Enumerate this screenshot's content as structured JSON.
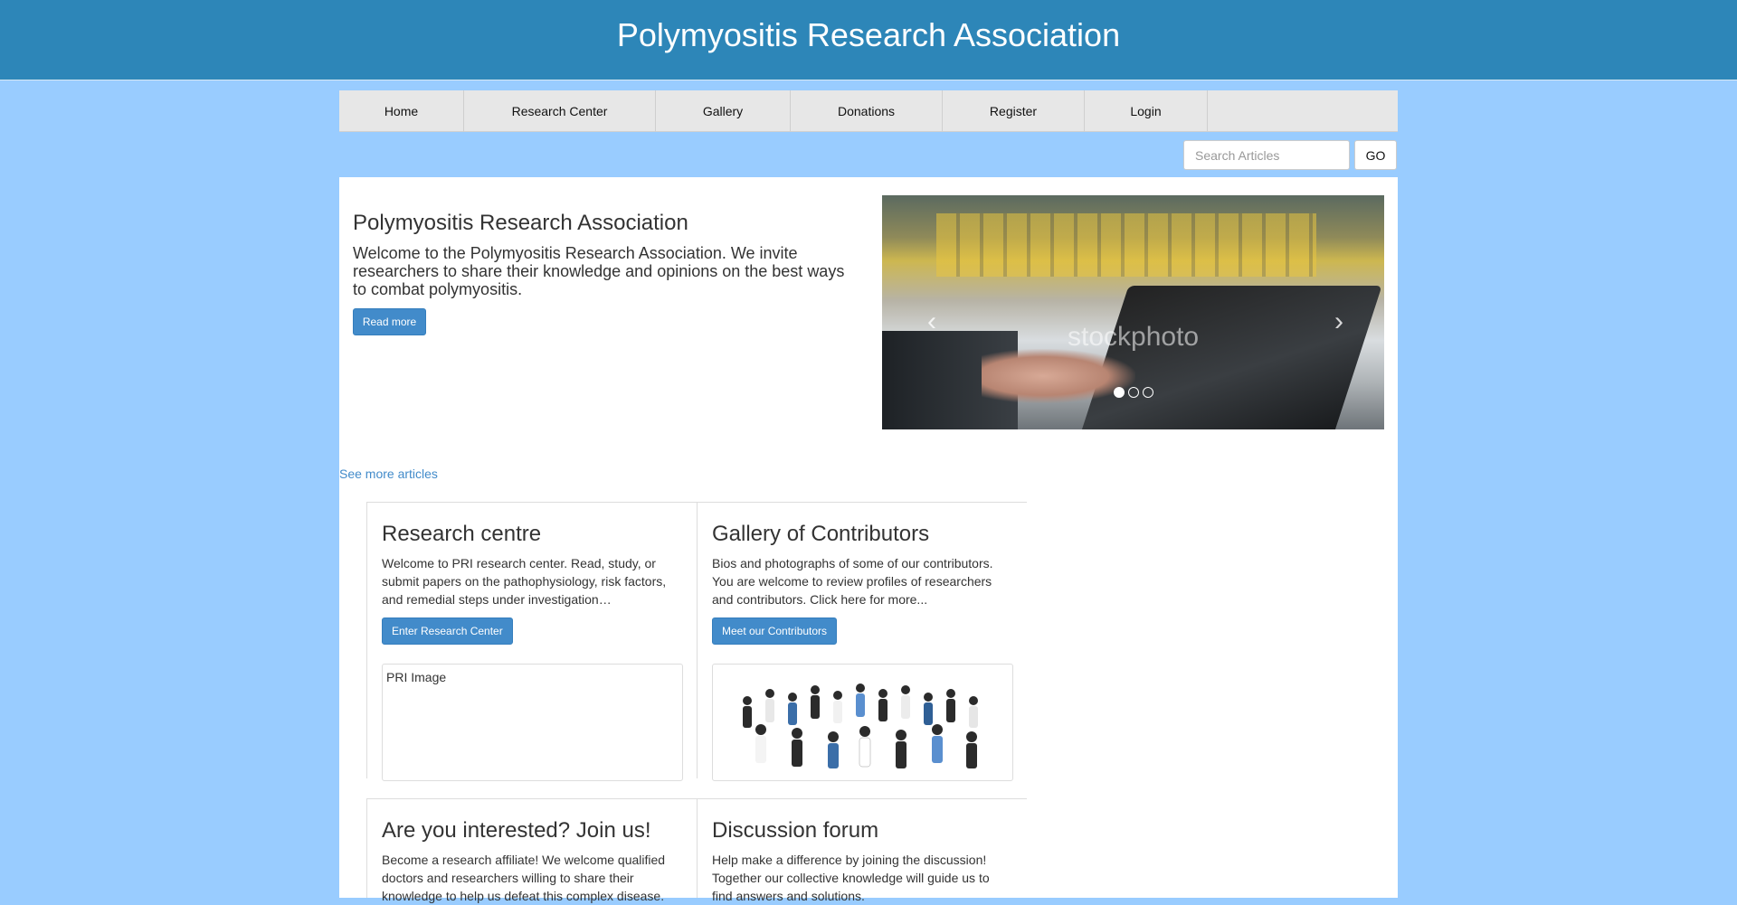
{
  "header": {
    "title": "Polymyositis Research Association"
  },
  "nav": {
    "items": [
      {
        "label": "Home"
      },
      {
        "label": "Research Center"
      },
      {
        "label": "Gallery"
      },
      {
        "label": "Donations"
      },
      {
        "label": "Register"
      },
      {
        "label": "Login"
      }
    ]
  },
  "search": {
    "placeholder": "Search Articles",
    "value": "",
    "button_label": "GO"
  },
  "hero": {
    "title": "Polymyositis Research Association",
    "text": "Welcome to the Polymyositis Research Association. We invite researchers to share their knowledge and opinions on the best ways to combat polymyositis.",
    "button_label": "Read more"
  },
  "carousel": {
    "watermark": "stockphoto",
    "prev_icon": "chevron-left-icon",
    "next_icon": "chevron-right-icon",
    "slide_count": 3,
    "active_slide": 1
  },
  "see_more": {
    "label": "See more articles"
  },
  "cards": [
    {
      "title": "Research centre",
      "text": "Welcome to PRI research center. Read, study, or submit papers on the pathophysiology, risk factors, and remedial steps under investigation…",
      "button_label": "Enter Research Center",
      "image_alt": "PRI Image"
    },
    {
      "title": "Gallery of Contributors",
      "text": "Bios and photographs of some of our contributors. You are welcome to review profiles of researchers and contributors. Click here for more...",
      "button_label": "Meet our Contributors"
    },
    {
      "title": "Are you interested? Join us!",
      "text": "Become a research affiliate! We welcome qualified doctors and researchers willing to share their knowledge to help us defeat this complex disease."
    },
    {
      "title": "Discussion forum",
      "text": "Help make a difference by joining the discussion! Together our collective knowledge will guide us to find answers and solutions."
    }
  ],
  "colors": {
    "header_bg": "#2d86b8",
    "page_bg": "#99ccff",
    "primary": "#428bca",
    "nav_bg": "#e7e7e7"
  }
}
